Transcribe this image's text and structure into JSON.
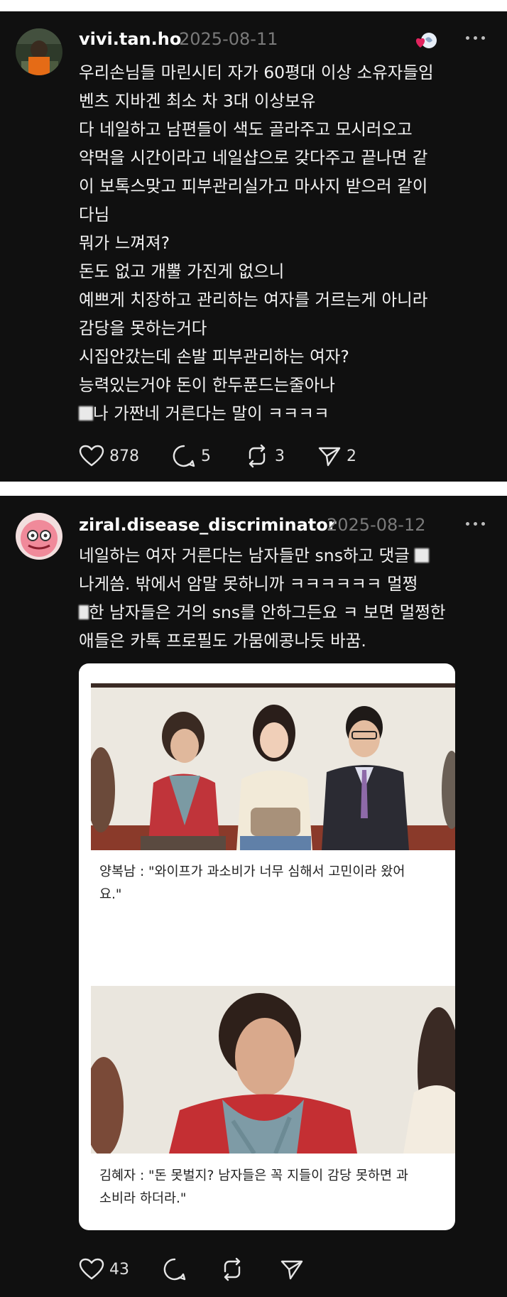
{
  "posts": [
    {
      "username": "vivi.tan.ho",
      "date": "2025-08-11",
      "lines": [
        "우리손님들 마린시티 자가 60평대 이상 소유자들임",
        "벤츠 지바겐 최소 차 3대 이상보유",
        "다 네일하고 남편들이 색도 골라주고 모시러오고",
        "약먹을 시간이라고 네일샵으로 갖다주고 끝나면 같",
        "이 보톡스맞고 피부관리실가고 마사지 받으러 같이",
        "다님",
        "뭐가 느껴져?",
        "돈도 없고 개뿔 가진게 없으니",
        "예쁘게 치장하고 관리하는 여자를 거르는게 아니라",
        "감당을 못하는거다",
        "시집안갔는데 손발 피부관리하는 여자?",
        "능력있는거야 돈이 한두푼드는줄아나",
        "나 가짠네 거른다는 말이 ㅋㅋㅋㅋ"
      ],
      "likes": "878",
      "replies": "5",
      "reposts": "3",
      "shares": "2"
    },
    {
      "username": "ziral.disease_discriminator",
      "date": "2025-08-12",
      "lines": [
        "네일하는 여자 거른다는 남자들만 sns하고 댓글",
        "나게씀. 밖에서 암말 못하니까 ㅋㅋㅋㅋㅋㅋ 멀쩡",
        "한 남자들은 거의 sns를 안하그든요 ㅋ 보면 멀쩡한",
        "애들은 카톡 프로필도 가뭄에콩나듯 바꿈."
      ],
      "card": {
        "caption1_line1": "양복남 : \"와이프가 과소비가 너무 심해서 고민이라 왔어",
        "caption1_line2": "요.\"",
        "caption2_line1": "김혜자 : \"돈 못벌지? 남자들은 꼭 지들이 감당 못하면 과",
        "caption2_line2": "소비라 하더라.\""
      },
      "likes": "43"
    }
  ],
  "colors": {
    "background": "#101010",
    "separator": "#ffffff",
    "username": "#ffffff",
    "date": "#7a7a7a",
    "like_badge": "#e0245e"
  },
  "icons": {
    "like": "heart-icon",
    "reply": "comment-bubble-icon",
    "repost": "repost-arrows-icon",
    "share": "send-paper-plane-icon",
    "more": "more-dots-icon"
  }
}
